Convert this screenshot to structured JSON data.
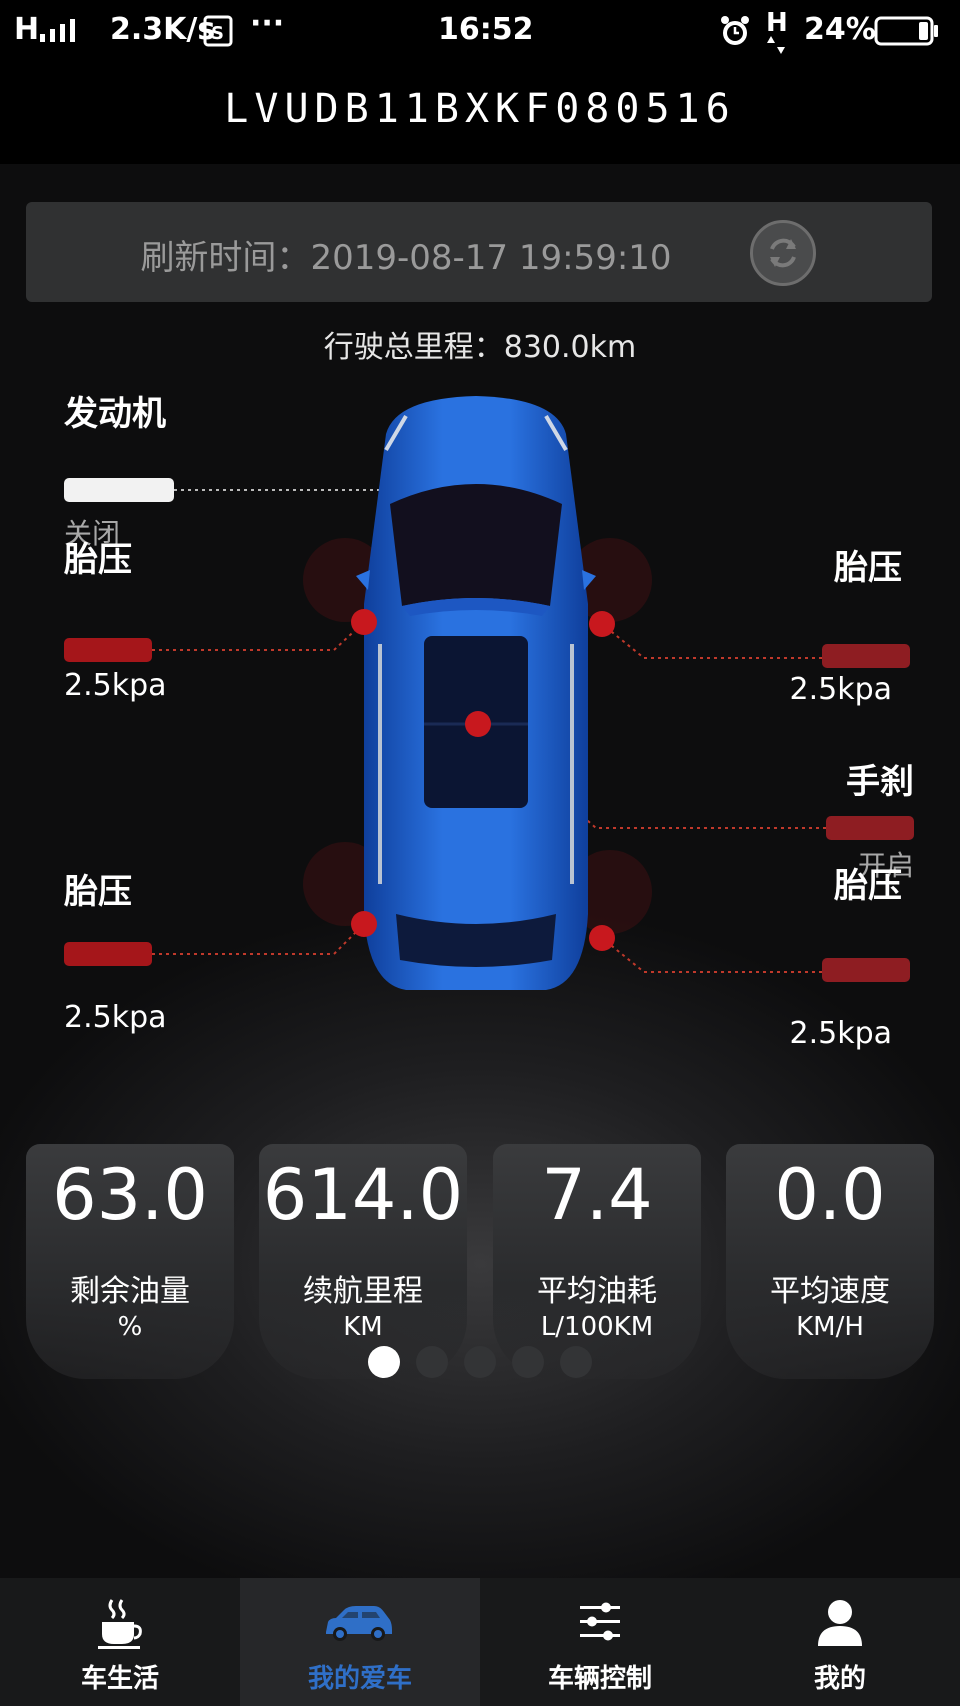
{
  "status_bar": {
    "signal": "H",
    "speed": "2.3K/s",
    "dots": "···",
    "time": "16:52",
    "network": "H",
    "battery": "24%"
  },
  "header": {
    "vin": "LVUDB11BXKF080516"
  },
  "refresh": {
    "label": "刷新时间：",
    "time": "2019-08-17 19:59:10"
  },
  "mileage": {
    "label": "行驶总里程：",
    "value": "830.0km"
  },
  "indicators": {
    "engine": {
      "title": "发动机",
      "status": "关闭"
    },
    "tire_front_left": {
      "title": "胎压",
      "value": "2.5kpa"
    },
    "tire_front_right": {
      "title": "胎压",
      "value": "2.5kpa"
    },
    "handbrake": {
      "title": "手刹",
      "status": "开启"
    },
    "tire_rear_left": {
      "title": "胎压",
      "value": "2.5kpa"
    },
    "tire_rear_right": {
      "title": "胎压",
      "value": "2.5kpa"
    }
  },
  "stats": [
    {
      "value": "63.0",
      "label": "剩余油量",
      "unit": "%"
    },
    {
      "value": "614.0",
      "label": "续航里程",
      "unit": "KM"
    },
    {
      "value": "7.4",
      "label": "平均油耗",
      "unit": "L/100KM"
    },
    {
      "value": "0.0",
      "label": "平均速度",
      "unit": "KM/H"
    }
  ],
  "pagination": {
    "count": 5,
    "active": 0
  },
  "nav": [
    {
      "label": "车生活",
      "icon": "coffee-cup-icon"
    },
    {
      "label": "我的爱车",
      "icon": "car-icon"
    },
    {
      "label": "车辆控制",
      "icon": "sliders-icon"
    },
    {
      "label": "我的",
      "icon": "user-icon"
    }
  ],
  "colors": {
    "accent_blue": "#2f6fc7",
    "alert_red": "#a5161a",
    "car_blue": "#1f5fd0"
  }
}
